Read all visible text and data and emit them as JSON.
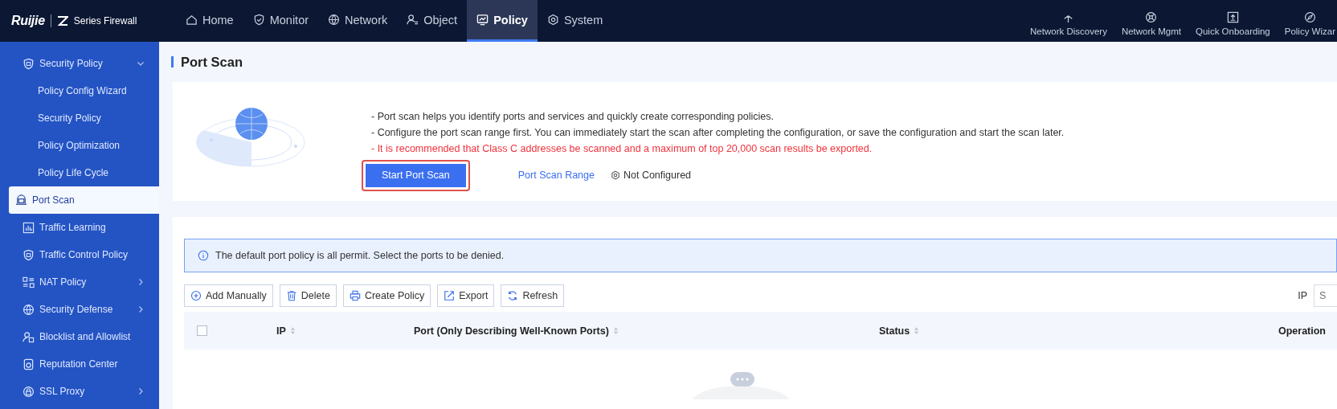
{
  "header": {
    "logo": "Ruijie",
    "product": "Series Firewall",
    "nav": [
      {
        "label": "Home",
        "selected": false
      },
      {
        "label": "Monitor",
        "selected": false
      },
      {
        "label": "Network",
        "selected": false
      },
      {
        "label": "Object",
        "selected": false
      },
      {
        "label": "Policy",
        "selected": true
      },
      {
        "label": "System",
        "selected": false
      }
    ],
    "tools": [
      "Network Discovery",
      "Network Mgmt",
      "Quick Onboarding",
      "Policy Wizar"
    ]
  },
  "sidebar": {
    "items": [
      {
        "label": "Security Policy",
        "kind": "group",
        "expanded": true,
        "selected": false,
        "children": [
          {
            "label": "Policy Config Wizard",
            "selected": false
          },
          {
            "label": "Security Policy",
            "selected": false
          },
          {
            "label": "Policy Optimization",
            "selected": false
          },
          {
            "label": "Policy Life Cycle",
            "selected": false
          }
        ]
      },
      {
        "label": "Port Scan",
        "kind": "item",
        "selected": true
      },
      {
        "label": "Traffic Learning",
        "kind": "item",
        "selected": false
      },
      {
        "label": "Traffic Control Policy",
        "kind": "item",
        "selected": false
      },
      {
        "label": "NAT Policy",
        "kind": "group",
        "expanded": false,
        "selected": false
      },
      {
        "label": "Security Defense",
        "kind": "group",
        "expanded": false,
        "selected": false
      },
      {
        "label": "Blocklist and Allowlist",
        "kind": "item",
        "selected": false
      },
      {
        "label": "Reputation Center",
        "kind": "item",
        "selected": false
      },
      {
        "label": "SSL Proxy",
        "kind": "group",
        "expanded": false,
        "selected": false
      }
    ]
  },
  "page": {
    "title": "Port Scan",
    "intro": [
      {
        "kind": "info",
        "text": "- Port scan helps you identify ports and services and quickly create corresponding policies."
      },
      {
        "kind": "info",
        "text": "- Configure the port scan range first. You can immediately start the scan after completing the configuration, or save the configuration and start the scan later."
      },
      {
        "kind": "warning",
        "text": "- It is recommended that Class C addresses be scanned and a maximum of top 20,000 scan results be exported."
      }
    ],
    "start_button": {
      "label": "Start Port Scan",
      "highlighted": true
    },
    "range_link": "Port Scan Range",
    "range_status": "Not Configured",
    "alert": "The default port policy is all permit. Select the ports to be denied.",
    "toolbar": [
      "Add Manually",
      "Delete",
      "Create Policy",
      "Export",
      "Refresh"
    ],
    "filter": {
      "label": "IP",
      "placeholder": "S"
    },
    "table": {
      "select_all": {
        "checked": false
      },
      "columns": [
        {
          "label": "IP",
          "sortable": true
        },
        {
          "label": "Port (Only Describing Well-Known Ports)",
          "sortable": true
        },
        {
          "label": "Status",
          "sortable": true
        },
        {
          "label": "Operation",
          "sortable": false
        }
      ]
    }
  }
}
